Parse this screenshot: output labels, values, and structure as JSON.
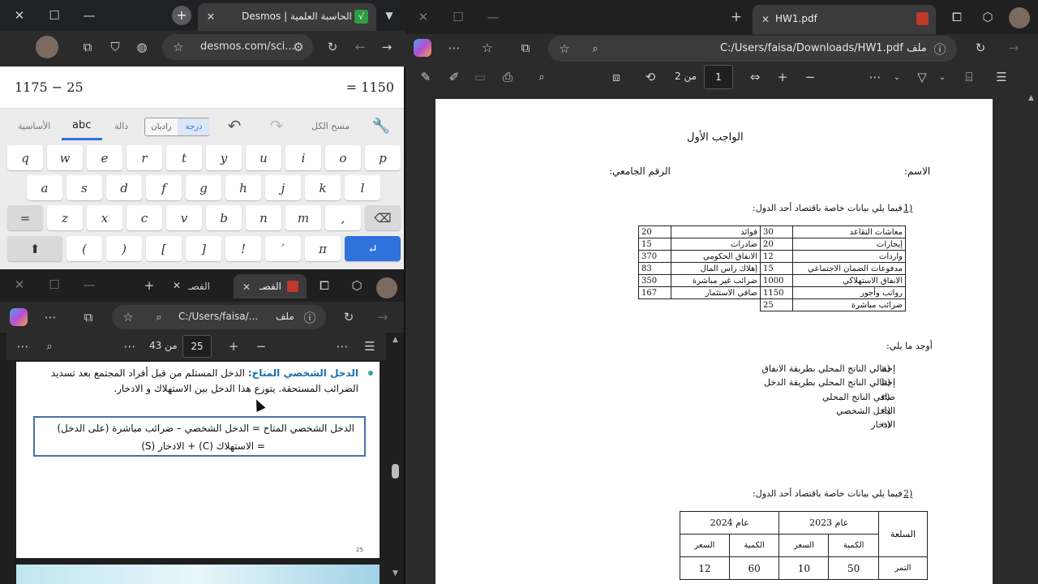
{
  "desmos": {
    "tab_title": "الحاسبة العلمية | Desmos",
    "url": "desmos.com/sci...",
    "expression": "1175 − 25",
    "result": "= 1150",
    "kbd_tabs": [
      "الأساسية",
      "abc",
      "دالة"
    ],
    "angle": [
      "راديان",
      "درجة"
    ],
    "clear_all": "مسح الكل",
    "rows": [
      [
        "q",
        "w",
        "e",
        "r",
        "t",
        "y",
        "u",
        "i",
        "o",
        "p"
      ],
      [
        "a",
        "s",
        "d",
        "f",
        "g",
        "h",
        "j",
        "k",
        "l"
      ],
      [
        "z",
        "x",
        "c",
        "v",
        "b",
        "n",
        "m",
        ","
      ],
      [
        "(",
        ")",
        "[",
        "]",
        "!",
        "′",
        "π"
      ]
    ],
    "eq_key": "="
  },
  "left_pdf": {
    "tab_label": "الفصـ",
    "tab_label2": "الفصـ",
    "path": "C:/Users/faisa/...",
    "file_label": "ملف",
    "page_num": "25",
    "page_total": "من 43",
    "bullet_title": "الدخل الشخصي المتاح:",
    "bullet_text": "الدخل المستلم من قبل أفراد المجتمع بعد تسديد",
    "bullet_text2": "الضرائب المستحقة. يتوزع هذا الدخل بين الاستهلاك و الادخار.",
    "box_line1": "الدخل الشخصي المتاح = الدخل الشخصي – ضرائب مباشرة (على الدخل)",
    "box_line2": "= الاستهلاك (C) + الادخار (S)",
    "page_footer": "25"
  },
  "right_pdf": {
    "tab_title": "HW1.pdf",
    "path": "C:/Users/faisa/Downloads/HW1.pdf",
    "file_label": "ملف",
    "page_num": "1",
    "page_total": "من 2",
    "title": "الواجب الأول",
    "name_label": "الاسم:",
    "id_label": "الرقم الجامعي:",
    "q1_num": "1)",
    "q1_text": "فيما يلي بيانات خاصة باقتصاد أحد الدول:",
    "table1": [
      [
        "معاشات التقاعد",
        "30",
        "فوائد",
        "20"
      ],
      [
        "إيجارات",
        "20",
        "صادرات",
        "15"
      ],
      [
        "واردات",
        "12",
        "الانفاق الحكومي",
        "370"
      ],
      [
        "مدفوعات الضمان الاجتماعي",
        "15",
        "إهلاك راس المال",
        "83"
      ],
      [
        "الانفاق الاستهلاكي",
        "1000",
        "ضرائب غير مباشرة",
        "350"
      ],
      [
        "رواتب وأجور",
        "1150",
        "صافي الاستثمار",
        "167"
      ],
      [
        "ضرائب مباشرة",
        "25",
        "",
        ""
      ]
    ],
    "find_label": "أوجد ما يلي:",
    "items": [
      {
        "l": "a)",
        "t": "إجمالي الناتج المحلي بطريقة الانفاق"
      },
      {
        "l": "b)",
        "t": "إجمالي الناتج المحلي بطريقة الدخل"
      },
      {
        "l": "c)",
        "t": "صافي الناتج المحلي"
      },
      {
        "l": "d)",
        "t": "الدخل الشخصي"
      },
      {
        "l": "e)",
        "t": "الادخار"
      }
    ],
    "q2_num": "2)",
    "q2_text": "فيما يلي بيانات خاصة باقتصاد أحد الدول:",
    "t2": {
      "good": "السلعة",
      "y2023": "عام 2023",
      "y2024": "عام 2024",
      "qty": "الكمية",
      "price": "السعر",
      "row1": [
        "التمر",
        "50",
        "10",
        "60",
        "12"
      ]
    }
  },
  "colors": {
    "accent": "#2f72dc",
    "tab_bg": "#202124"
  }
}
